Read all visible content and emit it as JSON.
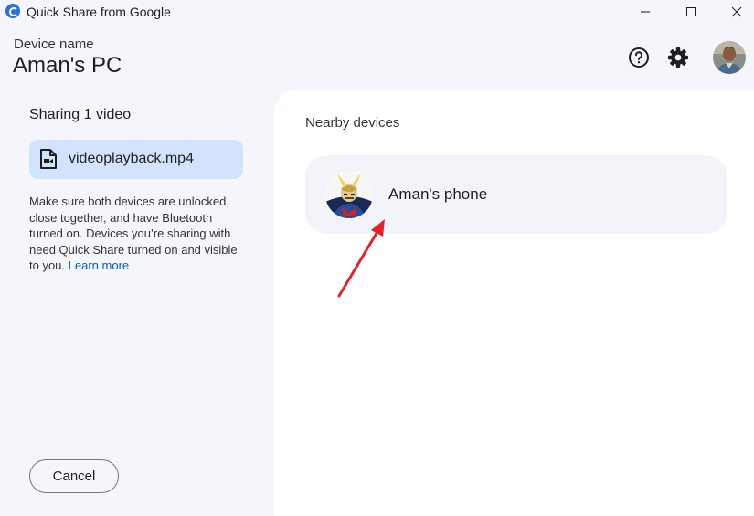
{
  "window": {
    "title": "Quick Share from Google"
  },
  "header": {
    "device_label": "Device name",
    "device_name": "Aman's PC"
  },
  "sharing": {
    "title": "Sharing 1 video",
    "file_name": "videoplayback.mp4",
    "info_text": "Make sure both devices are unlocked, close together, and have Bluetooth turned on. Devices you’re sharing with need Quick Share turned on and visible to you.",
    "learn_more": "Learn more",
    "cancel_label": "Cancel"
  },
  "nearby": {
    "title": "Nearby devices",
    "devices": [
      {
        "name": "Aman's phone"
      }
    ]
  },
  "icons": {
    "app": "quick-share-icon",
    "help": "help-icon",
    "settings": "gear-icon",
    "file": "video-file-icon"
  },
  "colors": {
    "accent": "#0b57d0",
    "file_chip_bg": "#d3e3fd",
    "annotation_arrow": "#e0232b"
  }
}
